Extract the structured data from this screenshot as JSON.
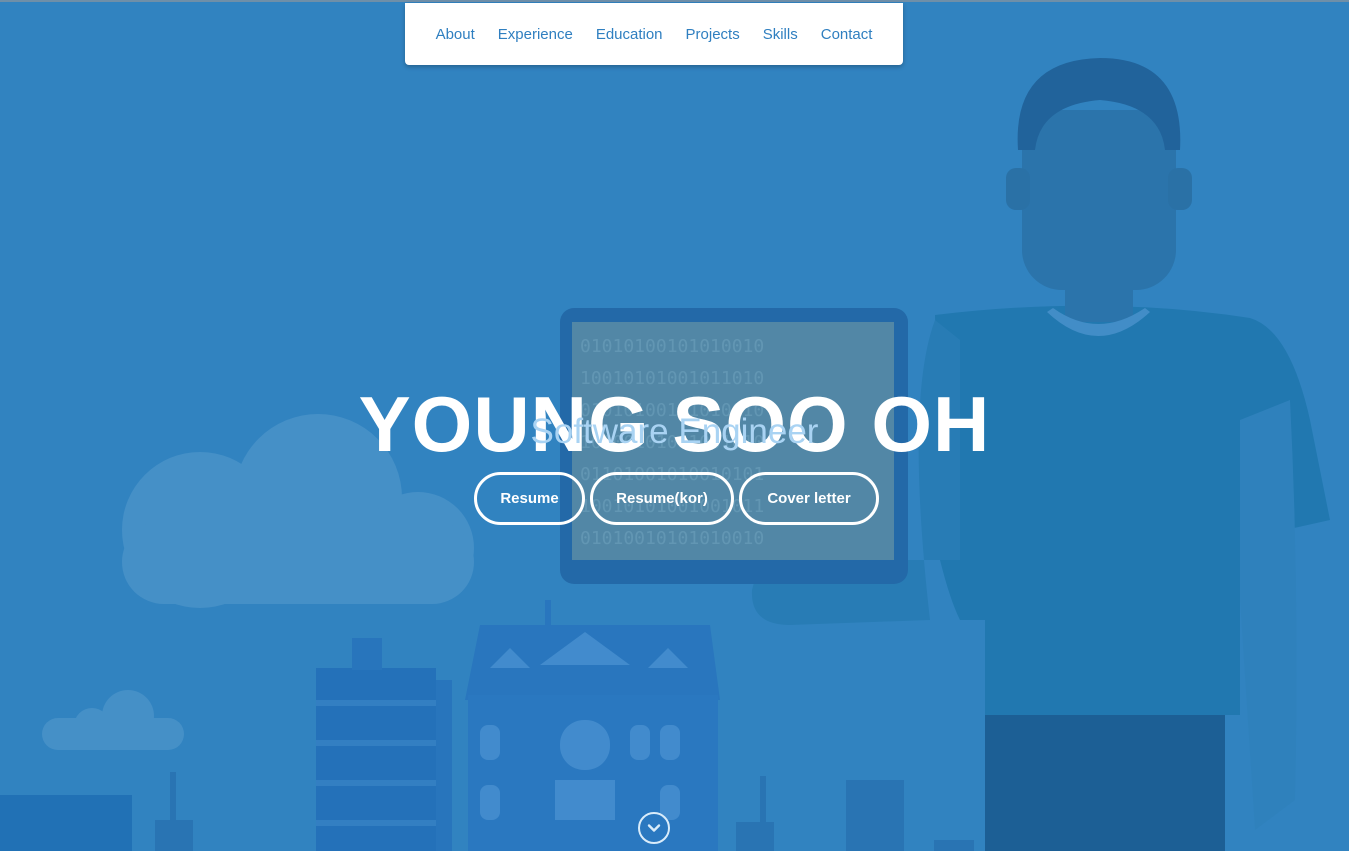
{
  "nav": {
    "items": [
      {
        "label": "About"
      },
      {
        "label": "Experience"
      },
      {
        "label": "Education"
      },
      {
        "label": "Projects"
      },
      {
        "label": "Skills"
      },
      {
        "label": "Contact"
      }
    ]
  },
  "hero": {
    "name": "YOUNG SOO OH",
    "title": "Software Engineer",
    "buttons": [
      {
        "label": "Resume"
      },
      {
        "label": "Resume(kor)"
      },
      {
        "label": "Cover letter"
      }
    ],
    "scroll_icon": "chevron-down-icon"
  },
  "colors": {
    "background": "#3586c0",
    "nav_link": "#2f7fc0",
    "subtitle": "#a9d3f3",
    "button_border": "#ffffff"
  }
}
